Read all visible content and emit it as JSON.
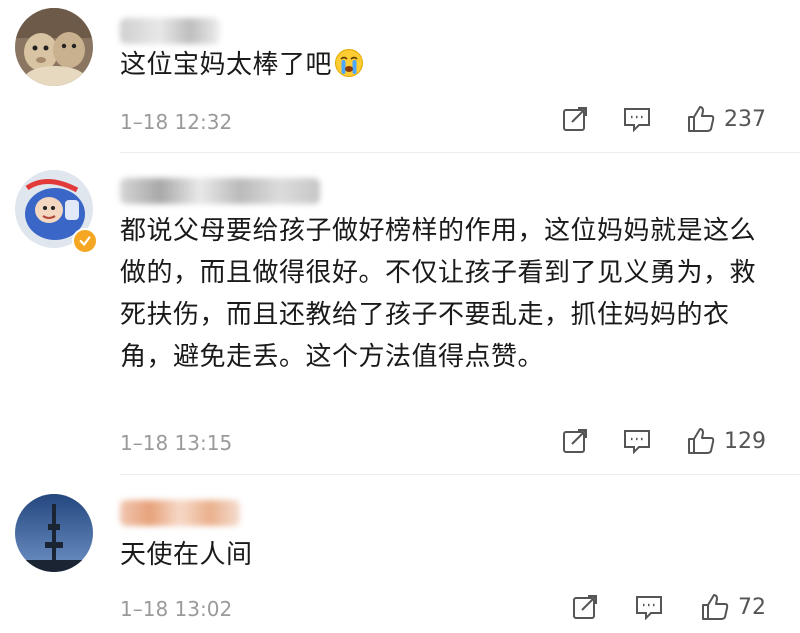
{
  "comments": [
    {
      "content": "这位宝妈太棒了吧",
      "emoji": "crying-face",
      "time": "1–18 12:32",
      "likes": "237"
    },
    {
      "content": "都说父母要给孩子做好榜样的作用，这位妈妈就是这么做的，而且做得很好。不仅让孩子看到了见义勇为，救死扶伤，而且还教给了孩子不要乱走，抓住妈妈的衣角，避免走丢。这个方法值得点赞。",
      "verified": true,
      "time": "1–18 13:15",
      "likes": "129"
    },
    {
      "content": "天使在人间",
      "time": "1–18 13:02",
      "likes": "72"
    }
  ],
  "colors": {
    "text": "#1a1a1a",
    "meta": "#9a9a9a",
    "icon": "#555555",
    "verified_badge": "#f5a623",
    "divider": "#ececec"
  },
  "icons": [
    "share-icon",
    "reply-icon",
    "thumbs-up-icon"
  ]
}
